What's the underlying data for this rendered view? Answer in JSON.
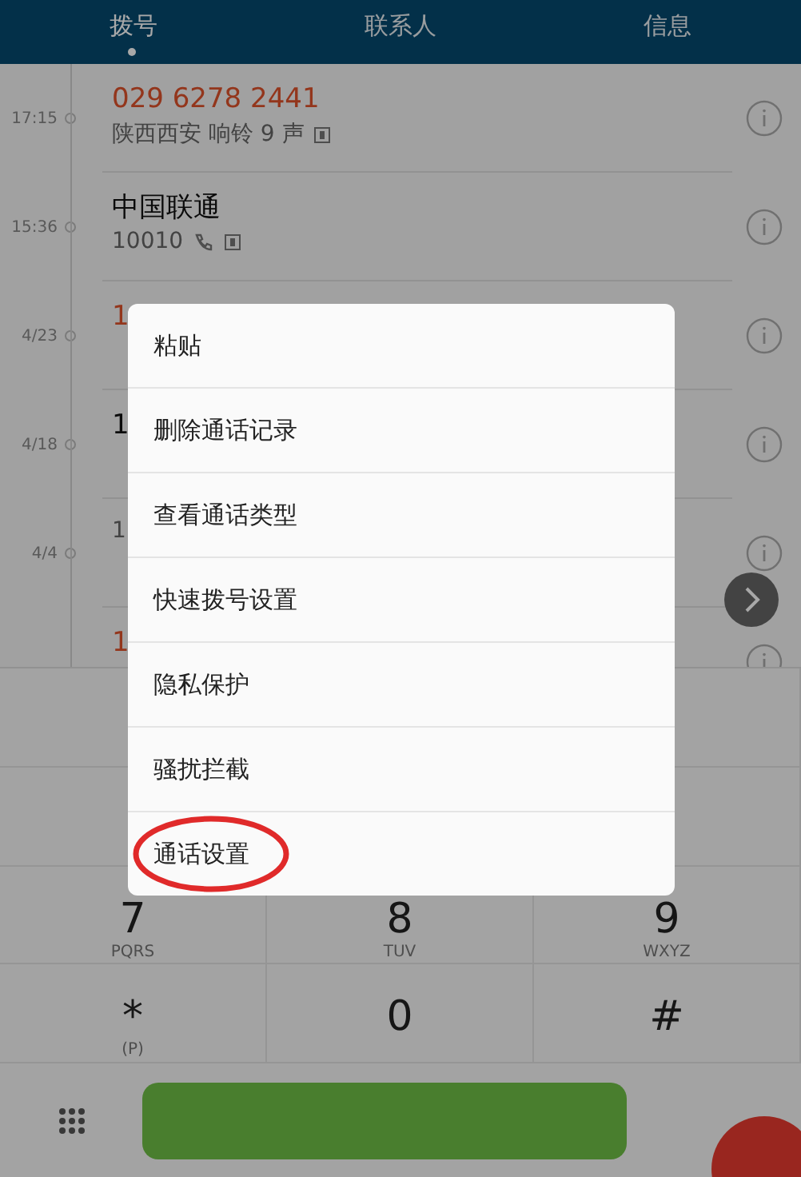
{
  "tabs": [
    {
      "label": "拨号",
      "selected": true
    },
    {
      "label": "联系人",
      "selected": false
    },
    {
      "label": "信息",
      "selected": false
    }
  ],
  "calls": [
    {
      "time": "17:15",
      "title": "029 6278 2441",
      "missed": true,
      "detail": "陕西西安 响铃 9 声",
      "sim": true
    },
    {
      "time": "15:36",
      "title": "中国联通",
      "missed": false,
      "detail": "10010",
      "call_icon": true,
      "sim": true
    },
    {
      "time": "4/23",
      "title": "1",
      "missed": true
    },
    {
      "time": "4/18",
      "title": "1",
      "missed": false
    },
    {
      "time": "4/4",
      "detail": "1"
    },
    {
      "title": "1",
      "missed": true
    }
  ],
  "keypad": [
    {
      "digit": "7",
      "letters": "PQRS"
    },
    {
      "digit": "8",
      "letters": "TUV"
    },
    {
      "digit": "9",
      "letters": "WXYZ"
    },
    {
      "digit": "*",
      "letters": "(P)"
    },
    {
      "digit": "0"
    },
    {
      "digit": "#"
    }
  ],
  "menu": {
    "items": [
      {
        "label": "粘贴",
        "circled": false
      },
      {
        "label": "删除通话记录",
        "circled": false
      },
      {
        "label": "查看通话类型",
        "circled": false
      },
      {
        "label": "快速拨号设置",
        "circled": false
      },
      {
        "label": "隐私保护",
        "circled": false
      },
      {
        "label": "骚扰拦截",
        "circled": false
      },
      {
        "label": "通话设置",
        "circled": true
      }
    ]
  }
}
